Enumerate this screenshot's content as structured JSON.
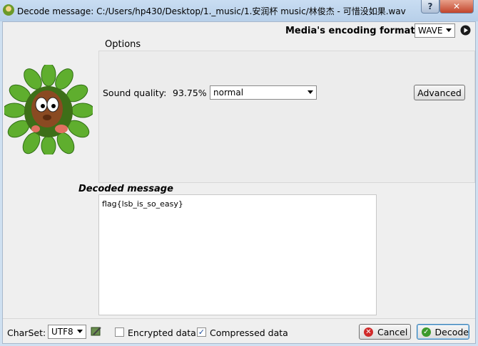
{
  "window": {
    "title": "Decode message: C:/Users/hp430/Desktop/1._music/1.安润杯 music/林俊杰 - 可惜没如果.wav",
    "help_label": "?",
    "close_label": "✕"
  },
  "encoding": {
    "label": "Media's encoding format :",
    "value": "WAVE"
  },
  "options": {
    "group_title": "Options",
    "sound_quality_label": "Sound quality:",
    "sound_quality_value": "93.75%",
    "quality_select": "normal",
    "advanced_label": "Advanced"
  },
  "decoded": {
    "title": "Decoded message",
    "text": "flag{lsb_is_so_easy}"
  },
  "footer": {
    "charset_label": "CharSet:",
    "charset_value": "UTF8",
    "encrypted_label": "Encrypted data",
    "encrypted_checked": false,
    "compressed_label": "Compressed data",
    "compressed_checked": true,
    "cancel_label": "Cancel",
    "decode_label": "Decode"
  },
  "icons": {
    "app": "app-icon",
    "play": "play-icon",
    "edit": "edit-icon",
    "cancel": "cancel-icon",
    "decode": "check-icon",
    "mascot": "mascot-icon"
  },
  "colors": {
    "titlebar": "#c1d6ee",
    "close": "#c2442b",
    "cancel_icon": "#d02a2a",
    "decode_icon": "#3b9a2c"
  }
}
